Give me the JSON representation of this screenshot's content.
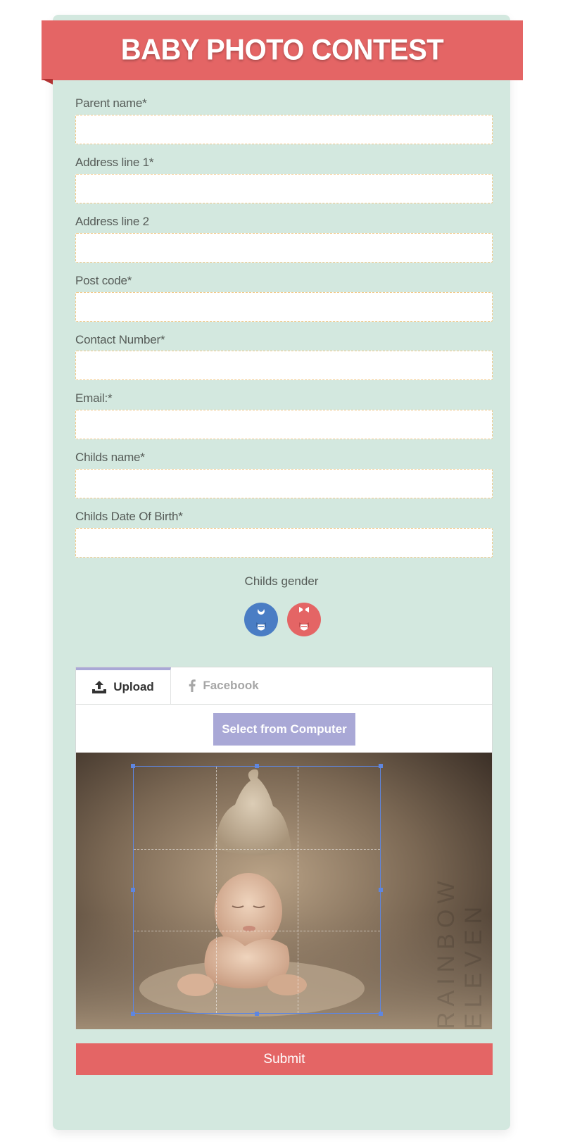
{
  "banner": {
    "title": "BABY PHOTO CONTEST"
  },
  "fields": [
    {
      "label": "Parent name*",
      "value": "",
      "placeholder": ""
    },
    {
      "label": "Address line 1*",
      "value": "",
      "placeholder": ""
    },
    {
      "label": "Address line 2",
      "value": "",
      "placeholder": ""
    },
    {
      "label": "Post code*",
      "value": "",
      "placeholder": ""
    },
    {
      "label": "Contact Number*",
      "value": "",
      "placeholder": ""
    },
    {
      "label": "Email:*",
      "value": "",
      "placeholder": ""
    },
    {
      "label": "Childs name*",
      "value": "",
      "placeholder": ""
    },
    {
      "label": "Childs Date Of Birth*",
      "value": "",
      "placeholder": ""
    }
  ],
  "gender": {
    "label": "Childs gender",
    "options": [
      {
        "icon": "baby-boy-icon",
        "color": "#4a7dc4"
      },
      {
        "icon": "baby-girl-icon",
        "color": "#e46565"
      }
    ]
  },
  "upload": {
    "tabs": [
      {
        "label": "Upload",
        "icon": "upload-icon",
        "active": true
      },
      {
        "label": "Facebook",
        "icon": "facebook-icon",
        "active": false
      }
    ],
    "select_button": "Select from Computer",
    "photo_watermark": "RAINBOW ELEVEN"
  },
  "submit": {
    "label": "Submit"
  },
  "colors": {
    "background": "#d3e8df",
    "accent": "#e46565",
    "button_purple": "#a9a8d6",
    "input_border": "#f2c98a",
    "crop_frame": "#5e86e0"
  }
}
